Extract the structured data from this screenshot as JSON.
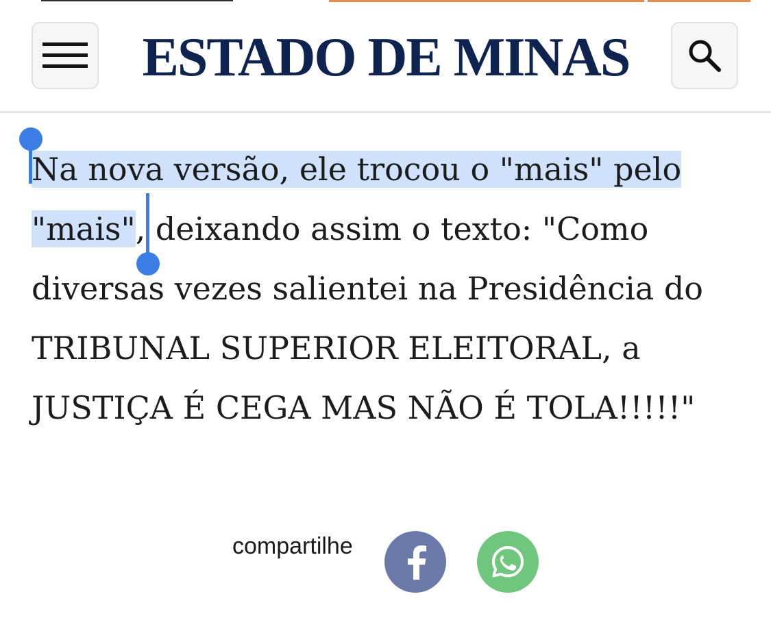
{
  "header": {
    "brand": "ESTADO DE MINAS",
    "menu_icon": "hamburger-menu-icon",
    "search_icon": "search-icon"
  },
  "article": {
    "selected_text": "Na nova versão, ele trocou o \"mais\" pelo \"mais\"",
    "rest_text": ", deixando assim o texto: \"Como diversas vezes salientei na Presidência do TRIBUNAL SUPERIOR ELEITORAL, a JUSTIÇA É CEGA MAS NÃO É TOLA!!!!!\""
  },
  "share": {
    "label": "compartilhe",
    "buttons": [
      {
        "icon": "facebook-icon",
        "color": "#6b7aa9"
      },
      {
        "icon": "whatsapp-icon",
        "color": "#6fc67c"
      }
    ]
  },
  "colors": {
    "brand": "#0f2350",
    "selection": "#cfe1fb",
    "handle": "#3a7ee5"
  }
}
